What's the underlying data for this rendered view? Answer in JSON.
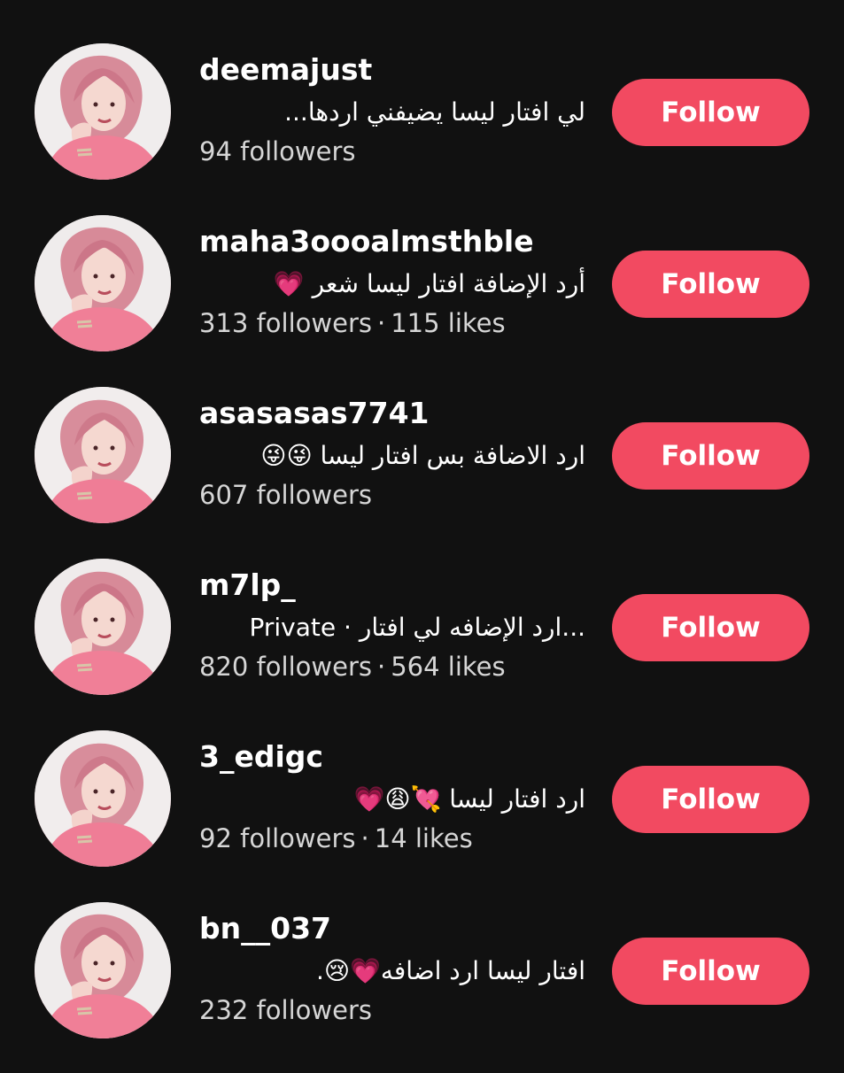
{
  "accounts": [
    {
      "username": "deemajust",
      "bio": "لي افتار ليسا يضيفني اردها...",
      "followers": "94 followers",
      "likes": "",
      "button": "Follow"
    },
    {
      "username": "maha3oooalmsthble",
      "bio": "أرد الإضافة افتار ليسا شعر 💗",
      "followers": "313 followers",
      "likes": "115 likes",
      "button": "Follow"
    },
    {
      "username": "asasasas7741",
      "bio": "ارد الاضافة بس افتار ليسا 😜😜",
      "followers": "607 followers",
      "likes": "",
      "button": "Follow"
    },
    {
      "username": "m7lp_",
      "bio": "Private · ارد الإضافه لي افتار...",
      "followers": "820 followers",
      "likes": "564 likes",
      "button": "Follow"
    },
    {
      "username": "3_edigc",
      "bio": "ارد افتار ليسا 💘😩💗",
      "followers": "92 followers",
      "likes": "14 likes",
      "button": "Follow"
    },
    {
      "username": "bn__037",
      "bio": "افتار ليسا ارد اضافه💗😢.",
      "followers": "232 followers",
      "likes": "",
      "button": "Follow"
    }
  ],
  "colors": {
    "background": "#111111",
    "follow_button": "#f24a61",
    "text": "#ffffff",
    "secondary_text": "#d6d6d6"
  },
  "icons": {
    "avatar": "profile-photo"
  }
}
